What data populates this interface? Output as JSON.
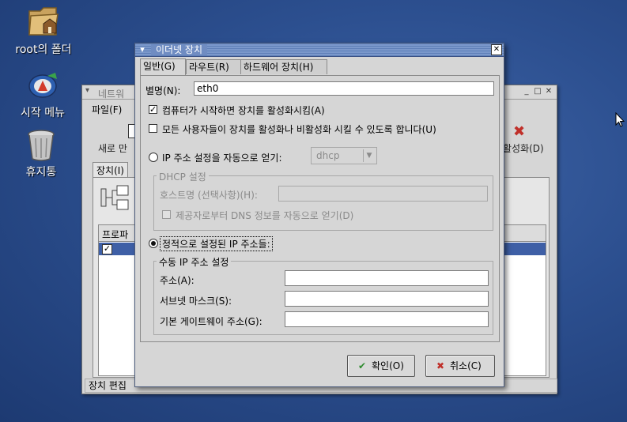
{
  "desktop": {
    "icons": [
      {
        "label": "root의 폴더"
      },
      {
        "label": "시작 메뉴"
      },
      {
        "label": "휴지통"
      }
    ]
  },
  "bg_window": {
    "title": "네트워",
    "menu": "파일(F)",
    "toolbar_new": "새로 만",
    "toolbar_deactivate": "활성화(D)",
    "tab": "장치(I)",
    "column_header": "프로파",
    "status": "장치 편집"
  },
  "dialog": {
    "title": "이더넷 장치",
    "tabs": [
      "일반(G)",
      "라우트(R)",
      "하드웨어 장치(H)"
    ],
    "nickname_label": "별명(N):",
    "nickname_value": "eth0",
    "activate_on_start": "컴퓨터가 시작하면 장치를 활성화시킴(A)",
    "allow_users": "모든 사용자들이 장치를 활성화나 비활성화 시킬 수 있도록 합니다(U)",
    "auto_ip_label": "IP 주소 설정을 자동으로 얻기:",
    "auto_ip_method": "dhcp",
    "dhcp_group": "DHCP 설정",
    "hostname_label": "호스트명 (선택사항)(H):",
    "dns_from_provider": "제공자로부터 DNS 정보를 자동으로 얻기(D)",
    "static_ip_label": "정적으로 설정된 IP 주소들:",
    "manual_group": "수동 IP 주소 설정",
    "address_label": "주소(A):",
    "subnet_label": "서브넷 마스크(S):",
    "gateway_label": "기본 게이트웨이 주소(G):",
    "ok_button": "확인(O)",
    "cancel_button": "취소(C)"
  },
  "colors": {
    "desktop": "#2c4f8f",
    "titlebar": "#6f8cc2",
    "window_bg": "#d6d6d6"
  }
}
